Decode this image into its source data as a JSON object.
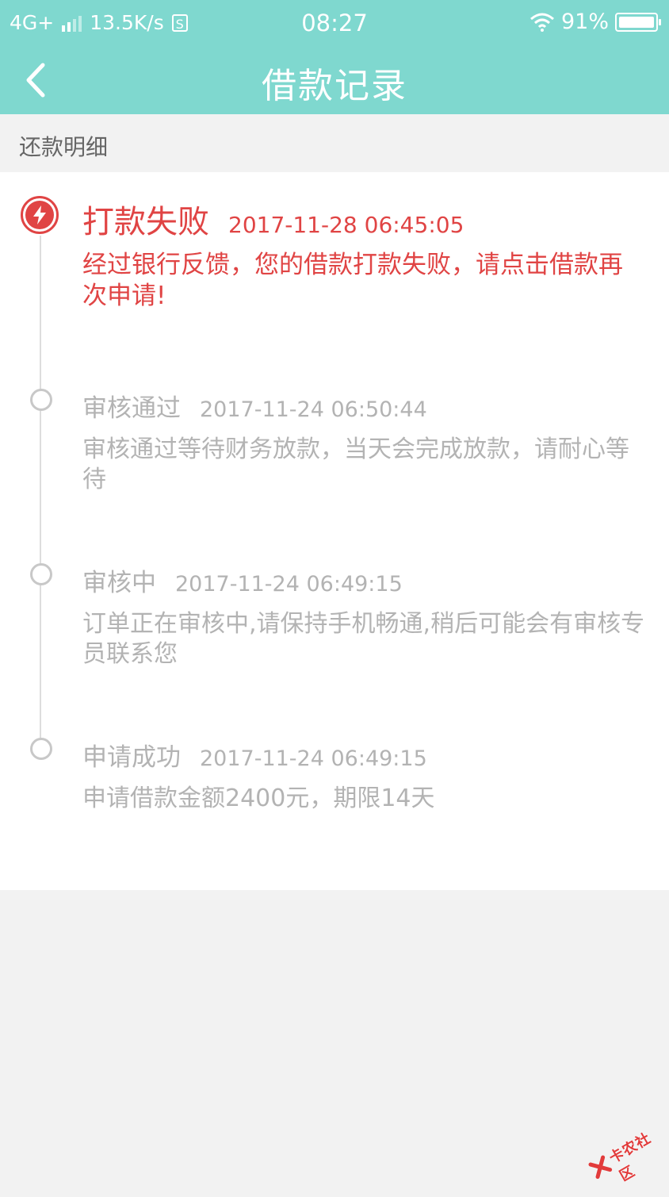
{
  "status_bar": {
    "network": "4G+",
    "speed": "13.5K/s",
    "s_badge": "S",
    "time": "08:27",
    "battery": "91%"
  },
  "nav": {
    "back_icon": "chevron-left-icon",
    "title": "借款记录"
  },
  "section": {
    "label": "还款明细"
  },
  "timeline": [
    {
      "status": "打款失败",
      "time": "2017-11-28 06:45:05",
      "desc": "经过银行反馈，您的借款打款失败，请点击借款再次申请!",
      "icon": "lightning-icon",
      "color": "#e04444"
    },
    {
      "status": "审核通过",
      "time": "2017-11-24 06:50:44",
      "desc": "审核通过等待财务放款，当天会完成放款，请耐心等待"
    },
    {
      "status": "审核中",
      "time": "2017-11-24 06:49:15",
      "desc": "订单正在审核中,请保持手机畅通,稍后可能会有审核专员联系您"
    },
    {
      "status": "申请成功",
      "time": "2017-11-24 06:49:15",
      "desc": "申请借款金额2400元，期限14天"
    }
  ],
  "watermark": {
    "text": "卡农社区"
  },
  "colors": {
    "header": "#7fd8cf",
    "error": "#e04444",
    "muted": "#b3b3b3"
  }
}
